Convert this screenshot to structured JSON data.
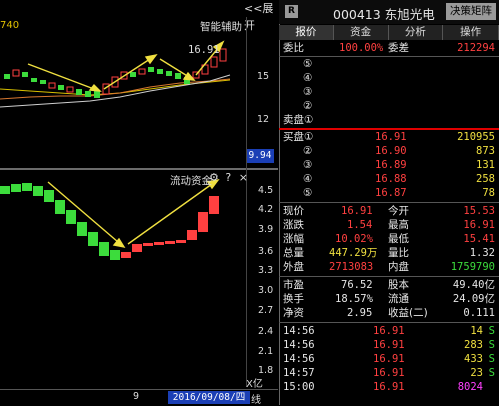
{
  "left_pane": {
    "expand_label": "<<展开",
    "ma_value": "740",
    "smart_assist_label": "智能辅助",
    "price_marker": "16.91",
    "price_axis": [
      "15",
      "12"
    ],
    "current_price_box": "9.94",
    "flow_title": "流动资金",
    "flow_icons": "⚙ ? ×",
    "flow_axis": [
      "4.5",
      "4.2",
      "3.9",
      "3.6",
      "3.3",
      "3.0",
      "2.7",
      "2.4",
      "2.1",
      "1.8"
    ],
    "unit_label": "X亿",
    "x_tick": "9",
    "date_label": "2016/09/08/四",
    "range_label": "线"
  },
  "header": {
    "badge": "R",
    "title": "000413 东旭光电",
    "decision_button": "决策矩阵"
  },
  "tabs": [
    {
      "label": "报价",
      "active": true
    },
    {
      "label": "资金",
      "active": false
    },
    {
      "label": "分析",
      "active": false
    },
    {
      "label": "操作",
      "active": false
    }
  ],
  "weibi": {
    "label": "委比",
    "value": "100.00%",
    "label2": "委差",
    "value2": "212294"
  },
  "sell_orders": [
    {
      "level": "⑤",
      "price": "",
      "volume": ""
    },
    {
      "level": "④",
      "price": "",
      "volume": ""
    },
    {
      "level": "③",
      "price": "",
      "volume": ""
    },
    {
      "level": "②",
      "price": "",
      "volume": ""
    },
    {
      "level": "卖盘①",
      "price": "",
      "volume": ""
    }
  ],
  "buy_orders": [
    {
      "level": "买盘①",
      "price": "16.91",
      "volume": "210955"
    },
    {
      "level": "②",
      "price": "16.90",
      "volume": "873"
    },
    {
      "level": "③",
      "price": "16.89",
      "volume": "131"
    },
    {
      "level": "④",
      "price": "16.88",
      "volume": "258"
    },
    {
      "level": "⑤",
      "price": "16.87",
      "volume": "78"
    }
  ],
  "stats_a": [
    {
      "l1": "现价",
      "v1": "16.91",
      "l2": "今开",
      "v2": "15.53"
    },
    {
      "l1": "涨跌",
      "v1": "1.54",
      "l2": "最高",
      "v2": "16.91"
    },
    {
      "l1": "涨幅",
      "v1": "10.02%",
      "l2": "最低",
      "v2": "15.41"
    },
    {
      "l1": "总量",
      "v1": "447.29万",
      "l2": "量比",
      "v2": "1.32"
    },
    {
      "l1": "外盘",
      "v1": "2713083",
      "l2": "内盘",
      "v2": "1759790"
    }
  ],
  "stats_b": [
    {
      "l1": "市盈",
      "v1": "76.52",
      "l2": "股本",
      "v2": "49.40亿"
    },
    {
      "l1": "换手",
      "v1": "18.57%",
      "l2": "流通",
      "v2": "24.09亿"
    },
    {
      "l1": "净资",
      "v1": "2.95",
      "l2": "收益(二)",
      "v2": "0.111"
    }
  ],
  "ticks": [
    {
      "time": "14:56",
      "price": "16.91",
      "vol": "14",
      "side": "S"
    },
    {
      "time": "14:56",
      "price": "16.91",
      "vol": "283",
      "side": "S"
    },
    {
      "time": "14:56",
      "price": "16.91",
      "vol": "433",
      "side": "S"
    },
    {
      "time": "14:57",
      "price": "16.91",
      "vol": "23",
      "side": "S"
    },
    {
      "time": "15:00",
      "price": "16.91",
      "vol": "8024",
      "side": ""
    }
  ],
  "colors": {
    "up": "#ff4040",
    "down": "#3cdc3c",
    "accent_blue": "#1b3fb5",
    "annotation": "#f0e040"
  }
}
